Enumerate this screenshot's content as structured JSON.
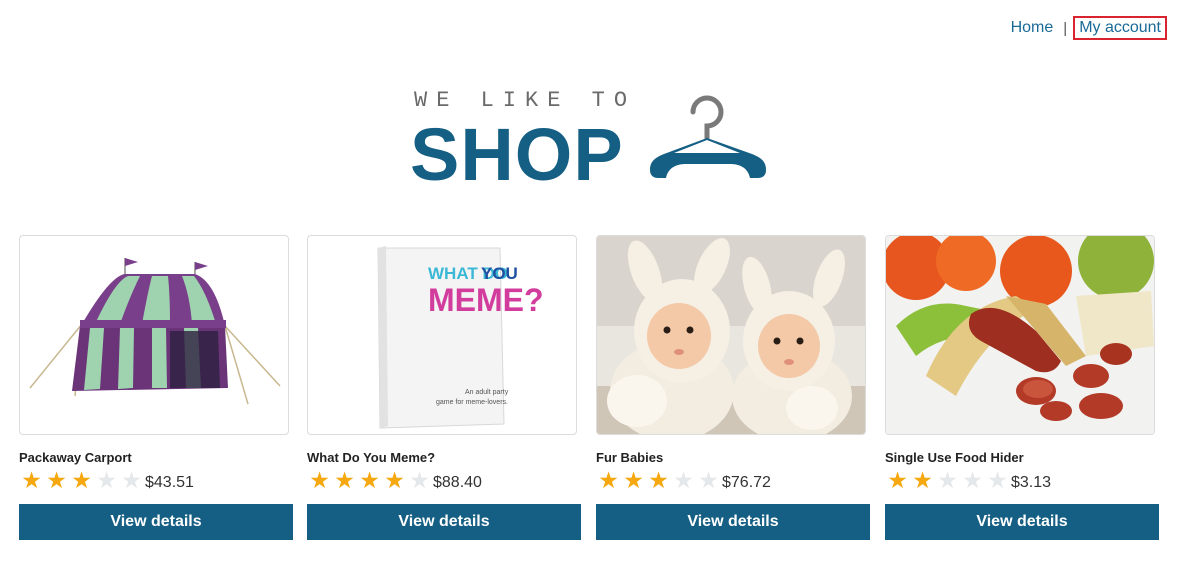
{
  "nav": {
    "home_label": "Home",
    "separator": "|",
    "account_label": "My account"
  },
  "logo": {
    "tagline": "WE LIKE TO",
    "word": "SHOP"
  },
  "products": [
    {
      "title": "Packaway Carport",
      "rating": 3,
      "price": "$43.51",
      "button_label": "View details"
    },
    {
      "title": "What Do You Meme?",
      "rating": 4,
      "price": "$88.40",
      "button_label": "View details",
      "box_text": {
        "line1": "WHAT DO",
        "line1b": "YOU",
        "line2": "MEME?",
        "small1": "An adult party",
        "small2": "game for meme-lovers."
      }
    },
    {
      "title": "Fur Babies",
      "rating": 3,
      "price": "$76.72",
      "button_label": "View details"
    },
    {
      "title": "Single Use Food Hider",
      "rating": 2,
      "price": "$3.13",
      "button_label": "View details"
    }
  ],
  "colors": {
    "brand": "#155f84",
    "link": "#1a6a96",
    "star": "#f5a80f",
    "focus_outline": "#d9232e"
  }
}
